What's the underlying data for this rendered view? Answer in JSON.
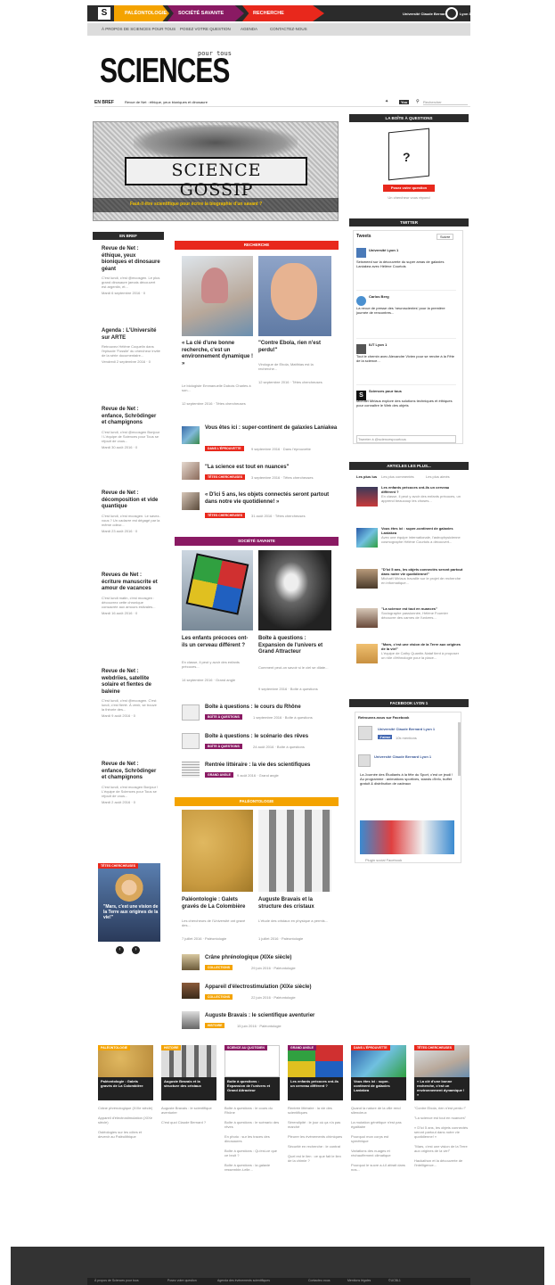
{
  "topnav": {
    "logo": "S",
    "tabs": [
      "PALÉONTOLOGIE",
      "SOCIÉTÉ SAVANTE",
      "RECHERCHE"
    ],
    "university": "Université Claude Bernard",
    "lyon": "Lyon 1"
  },
  "subnav": [
    "À PROPOS DE SCIENCES POUR TOUS",
    "POSEZ VOTRE QUESTION",
    "AGENDA",
    "CONTACTEZ-NOUS"
  ],
  "logo": {
    "main": "SCIENCES",
    "sub": "pour tous"
  },
  "ticker": {
    "label": "EN BREF",
    "text": "Revue de Net : éthique, yeux bioniques et dinosaure",
    "search": "Rechercher"
  },
  "hero": {
    "title": "SCIENCE GOSSIP",
    "caption": "Faut-il être scientifique pour écrire la biographie d'un savant ?"
  },
  "enbref": {
    "header": "EN BREF",
    "items": [
      {
        "title": "Revue de Net : éthique, yeux bioniques et dinosaure géant",
        "text": "C'est lundi, c'est @mcosgen. Le plus grand dinosaure jamais découvert est argentin, et...",
        "meta": "Mardi 6 septembre 2016 · 0"
      },
      {
        "title": "Agenda : L'Université sur ARTE",
        "text": "Retrouvez Hélène Coquelin dans l'épisode 'Fossile' du chercheur invité de la série documentaire...",
        "meta": "Vendredi 2 septembre 2016 · 0"
      },
      {
        "title": "Revue de Net : enfance, Schrödinger et champignons",
        "text": "C'est lundi, c'est @mcosgen Bonjour ! L'équipe de Sciences pour Tous se réjouit de vous...",
        "meta": "Mardi 30 août 2016 · 0"
      },
      {
        "title": "Revue de Net : décomposition et vide quantique",
        "text": "C'est lundi, c'est mcosgen. Le savez-vous ? Un cadavre est dégagé par la même odeur...",
        "meta": "Mardi 23 août 2016 · 0"
      },
      {
        "title": "Revues de Net : écriture manuscrite et amour de vacances",
        "text": "C'est lundi matin, c'est mcosgen : découvrez cette chronique consacrée aux amours estivales...",
        "meta": "Mardi 16 août 2016 · 0"
      },
      {
        "title": "Revue de Net : webdriies, satellite solaire et fientes de baleine",
        "text": "C'est lundi, c'est @mcosgen. C'est lundi, c'est fierté. À venir, se trouve la théorie des...",
        "meta": "Mardi 9 août 2016 · 0"
      },
      {
        "title": "Revue de Net : enfance, Schrödinger et champignons",
        "text": "C'est lundi, c'est mcosgen Bonjour ! L'équipe de Sciences pour Tous se réjouit de vous...",
        "meta": "Mardi 2 août 2016 · 0"
      }
    ]
  },
  "promo": {
    "tag": "TÊTES CHERCHEUSES",
    "title": "\"Mars, c'est une vision de la Terre aux origines de la vie!\""
  },
  "recherche": {
    "header": "RECHERCHE",
    "cards": [
      {
        "title": "« La clé d'une bonne recherche, c'est un environnement dynamique ! »",
        "text": "Le biologiste Emmanuelle Dubois Charles à son...",
        "meta": "12 septembre 2016 · Têtes chercheuses"
      },
      {
        "title": "\"Contre Ebola, rien n'est perdu!\"",
        "text": "Virologue de Ebola, Matthias est la recherche...",
        "meta": "12 septembre 2016 · Têtes chercheuses"
      }
    ],
    "list": [
      {
        "title": "Vous êtes ici : super-continent de galaxies Laniakea",
        "tag": "DANS L'ÉPROUVETTE",
        "meta": "9 septembre 2016 · Dans l'éprouvette"
      },
      {
        "title": "\"La science est tout en nuances\"",
        "tag": "TÊTES CHERCHEUSES",
        "meta": "3 septembre 2016 · Têtes chercheuses"
      },
      {
        "title": "« D'ici 5 ans, les objets connectés seront partout dans notre vie quotidienne! »",
        "tag": "TÊTES CHERCHEUSES",
        "meta": "31 août 2016 · Têtes chercheuses"
      }
    ]
  },
  "societe": {
    "header": "SOCIÉTÉ SAVANTE",
    "cards": [
      {
        "title": "Les enfants précoces ont-ils un cerveau différent ?",
        "text": "En classe, il peut y avoir des enfants précoces...",
        "meta": "14 septembre 2016 · Grand angle"
      },
      {
        "title": "Boîte à questions : Expansion de l'univers et Grand Attracteur",
        "text": "Comment peut-on savoir si le ciel se dilate...",
        "meta": "9 septembre 2016 · Boîte à questions"
      }
    ],
    "list": [
      {
        "title": "Boîte à questions : le cours du Rhône",
        "tag": "BOÎTE À QUESTIONS",
        "meta": "1 septembre 2016 · Boîte à questions"
      },
      {
        "title": "Boîte à questions : le scénario des rêves",
        "tag": "BOÎTE À QUESTIONS",
        "meta": "24 août 2016 · Boîte à questions"
      },
      {
        "title": "Rentrée littéraire : la vie des scientifiques",
        "tag": "GRAND ANGLE",
        "meta": "9 août 2016 · Grand angle"
      }
    ]
  },
  "paleo": {
    "header": "PALÉONTOLOGIE",
    "cards": [
      {
        "title": "Paléontologie : Galets gravés de La Colombière",
        "text": "Les chercheurs de l'Université ont gravé des...",
        "meta": "7 juillet 2016 · Paléontologie"
      },
      {
        "title": "Auguste Bravais et la structure des cristaux",
        "text": "L'étude des cristaux en physique a permis...",
        "meta": "1 juillet 2016 · Paléontologie"
      }
    ],
    "list": [
      {
        "title": "Crâne phrénologique (XIXe siècle)",
        "tag": "COLLECTIONS",
        "meta": "29 juin 2016 · Paléontologie"
      },
      {
        "title": "Appareil d'électrostimulation (XIXe siècle)",
        "tag": "COLLECTIONS",
        "meta": "22 juin 2016 · Paléontologie"
      },
      {
        "title": "Auguste Bravais : le scientifique aventurier",
        "tag": "HISTOIRE",
        "meta": "15 juin 2016 · Paléontologie"
      }
    ]
  },
  "question": {
    "header": "LA BOÎTE À QUESTIONS",
    "button": "Posez votre question",
    "text": "Un chercheur vous répond"
  },
  "twitter": {
    "header": "TWITTER",
    "label": "Tweets",
    "follow": "Suivre",
    "compose": "Tweeter à @sciencespourtous",
    "tweets": [
      {
        "user": "Université Lyon 1",
        "text": "Seismeed sur la découverte du super amas de galaxies Laniakea avec Hélène Courtois",
        "time": "9 sept"
      },
      {
        "user": "Carlos Berg",
        "text": "La revue de presse des 'neuroscientes' pour la première journée de rencontres...",
        "time": "11 sept"
      },
      {
        "user": "IUT Lyon 1",
        "text": "Tout le chemin avec Alexandre Vivien pour se rendre à la Fête de la science...",
        "time": "9 sept"
      },
      {
        "user": "Sciences pour tous",
        "text": "Michaël Mirlaus explore des solutions techniques et éthiques pour connaître le Web des objets",
        "time": "8 sept"
      }
    ]
  },
  "articles": {
    "header": "ARTICLES LES PLUS...",
    "tabs": [
      "Les plus lus",
      "Les plus commentés",
      "Les plus aimés"
    ],
    "items": [
      {
        "title": "Les enfants précoces ont-ils un cerveau différent ?",
        "text": "En classe, il peut y avoir des enfants précoces, un apprend beaucoup les choses..."
      },
      {
        "title": "Vous êtes ici : super-continent de galaxies Laniakea",
        "text": "Avec une équipe internationale, l'astrophysicienne cosmographe Hélène Courtois a découvert..."
      },
      {
        "title": "\"D'ici 5 ans, les objets connectés seront partout dans notre vie quotidienne!\"",
        "text": "Michaël Mirlaus travaille sur le projet de recherche en informatique..."
      },
      {
        "title": "\"La science est tout en nuances\"",
        "text": "Sociographe passionnée, Hélène Fournier découvre des carnes de l'univers..."
      },
      {
        "title": "\"Mars, c'est une vision de la Terre aux origines de la vie!\"",
        "text": "L'équipe de Cathy Quantin-Nataf tient à proposer un rôle d'éthnologie pour la place..."
      }
    ]
  },
  "facebook": {
    "header": "FACEBOOK LYON 1",
    "label": "Retrouvez-nous sur Facebook",
    "page": "Université Claude Bernard Lyon 1",
    "like": "J'aime",
    "likes": "10k mentions",
    "post": "La Journée des Étudiants à la fête du Sport, c'est ce jeudi ! Au programme : animations sportives, stands d'info, buffet gratuit & distribution de cadeaux",
    "footer": "Plugin social Facebook"
  },
  "bottom": [
    {
      "tag": "PALÉONTOLOGIE",
      "title": "Paléontologie : Galets gravés de La Colombière",
      "links": [
        "Crâne phrénologique (XIXe siècle)",
        "Appareil d'électrostimulation (XIXe siècle)",
        "Ostéologies sur les côtes et devenir au Paléolithique"
      ]
    },
    {
      "tag": "HISTOIRE",
      "title": "Auguste Bravais et la structure des cristaux",
      "links": [
        "Auguste Bravais : le scientifique aventurier",
        "C'est quoi Claude Bernard ?"
      ]
    },
    {
      "tag": "SCIENCE AU QUOTIDIEN",
      "title": "Boîte à questions : Expansion de l'univers et Grand Attracteur",
      "links": [
        "Boîte à questions : le cours du Rhône",
        "Boîte à questions : le scénario des rêves",
        "En photo : sur les traces des dinosaures",
        "Boîte à questions : Qu'est-ce que ce bruit ?",
        "Boîte à questions : la galaxie ressemble-t-elle..."
      ]
    },
    {
      "tag": "GRAND ANGLE",
      "title": "Les enfants précoces ont-ils un cerveau différent ?",
      "links": [
        "Rentrée littéraire : la vie des scientifiques",
        "Sérendipité : le jour où ça n'a pas marché",
        "Pleurer les événements chimiques",
        "Sécurité en recherche : le contrat",
        "Quel est le lien : ce que fait le lien de la chimie ?"
      ]
    },
    {
      "tag": "DANS L'ÉPROUVETTE",
      "title": "Vous êtes ici : super-continent de galaxies Laniakea",
      "links": [
        "Quand la nature de la ville rend silencieux",
        "La mutation génétique n'est pas égalitaire",
        "Pourquoi mon corps est symétrique",
        "Variations des nuages et réchauffement climatique",
        "Pourquoi le sucre a-t-il attrait dans nos..."
      ]
    },
    {
      "tag": "TÊTES CHERCHEUSES",
      "title": "« La clé d'une bonne recherche, c'est un environnement dynamique ! »",
      "links": [
        "\"Contre Ebola, rien n'est perdu !\"",
        "\"La science est tout en nuances\"",
        "« D'ici 5 ans, les objets connectés seront partout dans notre vie quotidienne! »",
        "\"Mars, c'est une vision de la Terre aux origines de la vie!\"",
        "Hackathon et la découverte de l'intelligence..."
      ]
    }
  ],
  "footer": [
    "À propos de Sciences pour tous",
    "Posez votre question",
    "Agenda des événements scientifiques",
    "Contactez-nous",
    "Mentions légales",
    "©UCBL1"
  ],
  "colors": {
    "paleo": "#f4a300",
    "societe": "#8a1a63",
    "recherche": "#e8281c",
    "dark": "#2b2b2b"
  }
}
